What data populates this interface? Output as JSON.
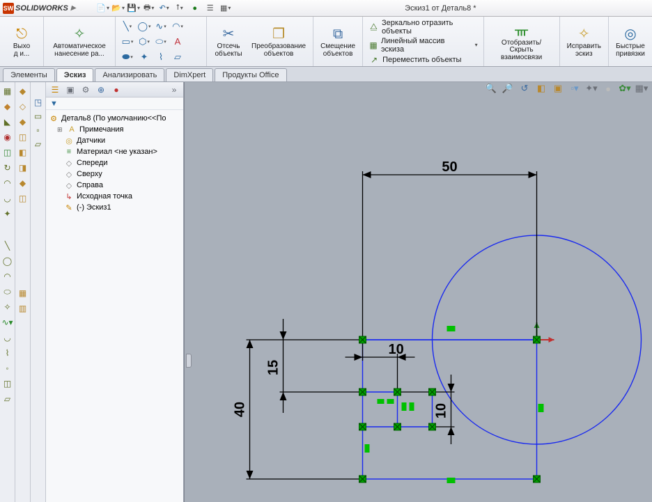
{
  "app": {
    "name": "SOLIDWORKS",
    "logoLetters": "SW",
    "doc_title": "Эскиз1 от Деталь8 *"
  },
  "ribbon": {
    "exit": "Выхо\nд и...",
    "autodim": "Автоматическое\nнанесение ра...",
    "trim": "Отсечь\nобъекты",
    "convert": "Преобразование\nобъектов",
    "offset": "Смещение\nобъектов",
    "mirror": "Зеркально отразить объекты",
    "linear": "Линейный массив эскиза",
    "move": "Переместить объекты",
    "display": "Отобразить/Скрыть\nвзаимосвязи",
    "repair": "Исправить\nэскиз",
    "quick": "Быстрые\nпривязки"
  },
  "tabs": {
    "elements": "Элементы",
    "sketch": "Эскиз",
    "analyze": "Анализировать",
    "dimxpert": "DimXpert",
    "office": "Продукты Office"
  },
  "tree": {
    "root": "Деталь8  (По умолчанию<<По",
    "notes": "Примечания",
    "sensors": "Датчики",
    "material": "Материал <не указан>",
    "front": "Спереди",
    "top": "Сверху",
    "right": "Справа",
    "origin": "Исходная точка",
    "sketch": "(-) Эскиз1"
  },
  "dims": {
    "d50": "50",
    "d40": "40",
    "d15": "15",
    "d10a": "10",
    "d10b": "10"
  }
}
